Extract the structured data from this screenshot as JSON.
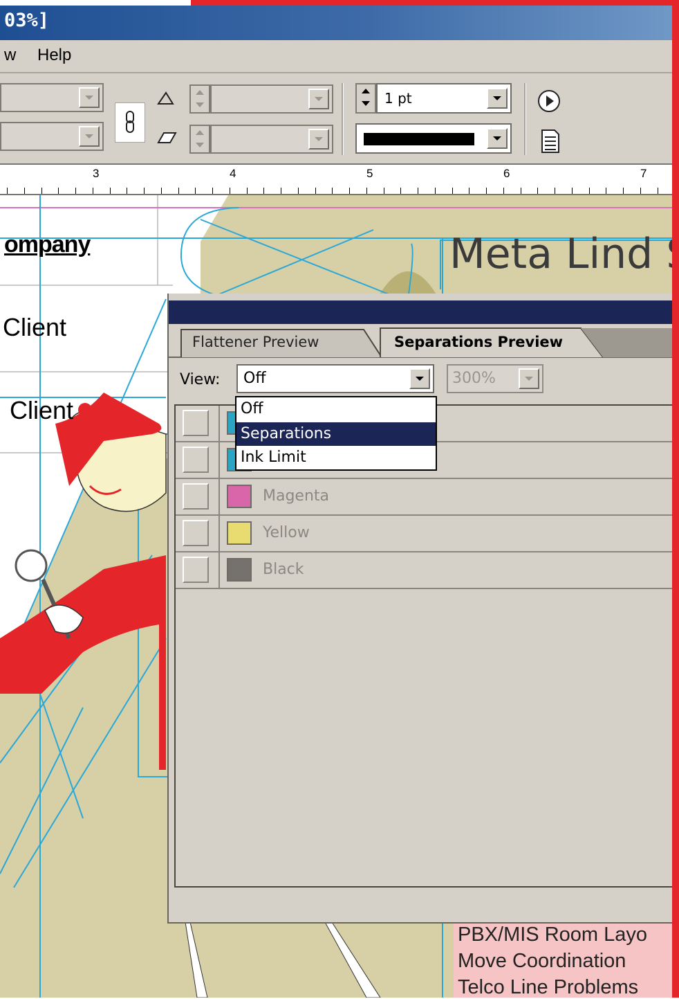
{
  "window": {
    "title": "03%]"
  },
  "menubar": {
    "items": [
      "w",
      "Help"
    ]
  },
  "control_bar": {
    "stroke_weight": "1 pt"
  },
  "ruler": {
    "labels": [
      "3",
      "4",
      "5",
      "6",
      "7"
    ]
  },
  "document": {
    "heading": "Meta Lind S",
    "table_cells": [
      "ompany",
      "Client",
      "Client"
    ],
    "services": [
      "PBX/MIS Room Layo",
      "Move Coordination",
      "Telco Line Problems"
    ]
  },
  "panel": {
    "tabs": [
      "Flattener Preview",
      "Separations Preview"
    ],
    "active_tab": "Separations Preview",
    "view_label": "View:",
    "view_value": "Off",
    "zoom_value": "300%",
    "view_options": [
      "Off",
      "Separations",
      "Ink Limit"
    ],
    "selected_option": "Separations",
    "inks": [
      {
        "name": "Magenta",
        "color": "#d966a8"
      },
      {
        "name": "Yellow",
        "color": "#e8dc70"
      },
      {
        "name": "Black",
        "color": "#75716c"
      }
    ],
    "hidden_ink_colors": [
      "#2aa6c4",
      "#2aa6c4"
    ]
  },
  "colors": {
    "panel_title": "#1c2656",
    "guide": "#2aa8d8",
    "page_fill": "#d7cfa5",
    "accent_red": "#e4262b"
  }
}
